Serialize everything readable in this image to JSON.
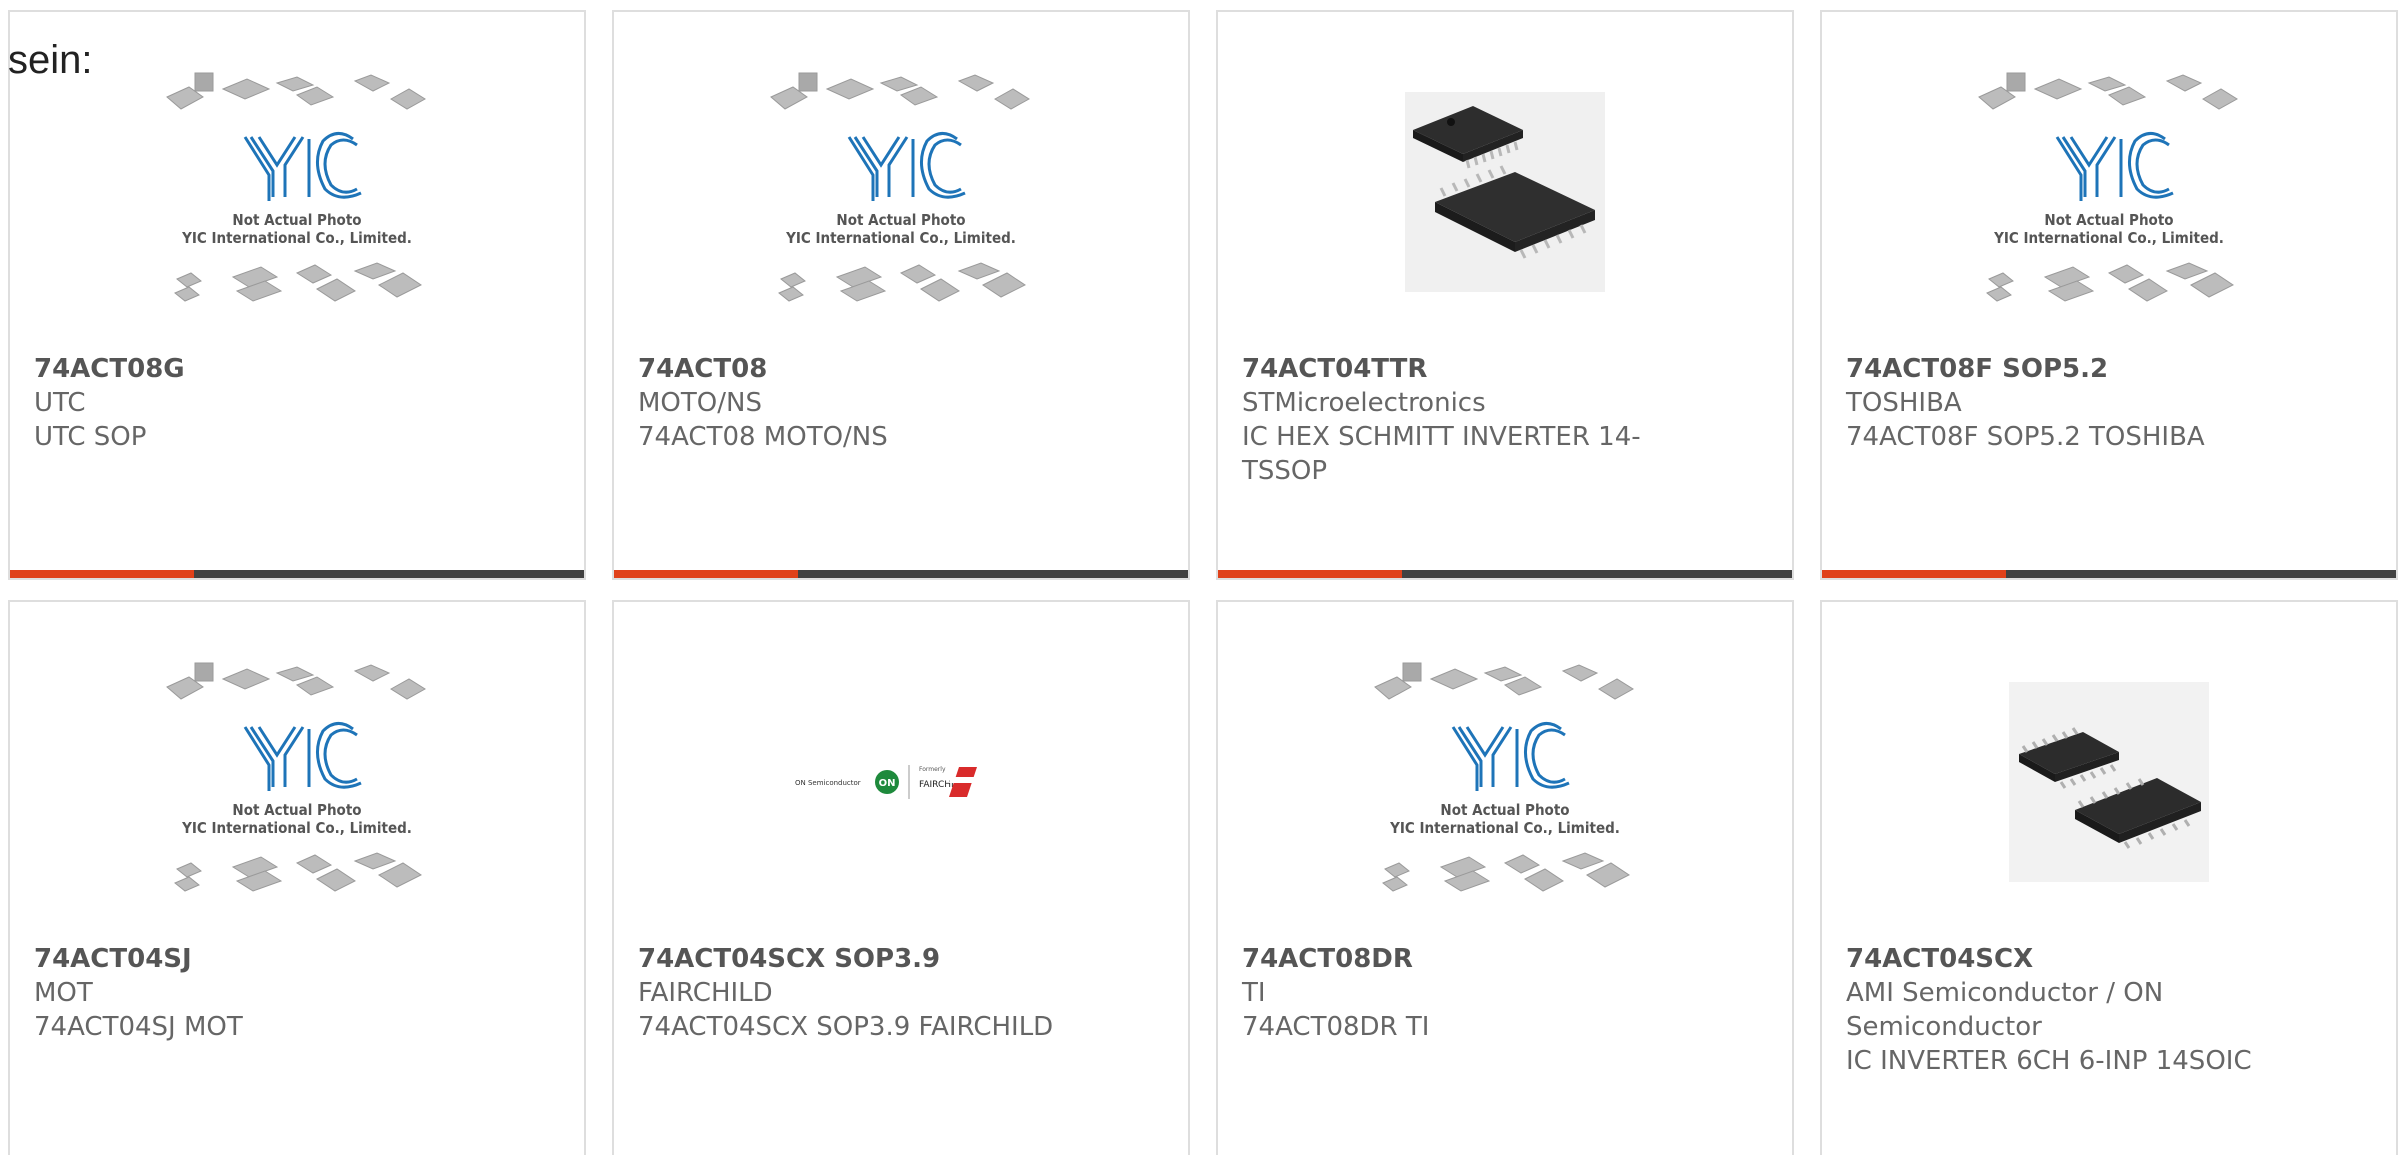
{
  "header": {
    "fragment": "sein:"
  },
  "placeholder": {
    "line1": "Not Actual Photo",
    "line2": "YIC International Co., Limited.",
    "logo": "YIC"
  },
  "colors": {
    "accent": "#e0411a",
    "bar": "#414141",
    "yic_blue": "#1e74b8"
  },
  "onsemi_logo": {
    "left_text": "ON Semiconductor",
    "badge": "ON",
    "formerly": "Formerly",
    "brand": "FAIRCHILD."
  },
  "cards": [
    {
      "part": "74ACT08G",
      "brand": "UTC",
      "desc": [
        "UTC SOP"
      ],
      "image": "yic-placeholder"
    },
    {
      "part": "74ACT08",
      "brand": "MOTO/NS",
      "desc": [
        "74ACT08 MOTO/NS"
      ],
      "image": "yic-placeholder"
    },
    {
      "part": "74ACT04TTR",
      "brand": "STMicroelectronics",
      "desc": [
        "IC HEX SCHMITT INVERTER 14-",
        "TSSOP"
      ],
      "image": "tssop-photo"
    },
    {
      "part": "74ACT08F SOP5.2",
      "brand": "TOSHIBA",
      "desc": [
        "74ACT08F SOP5.2 TOSHIBA"
      ],
      "image": "yic-placeholder"
    },
    {
      "part": "74ACT04SJ",
      "brand": "MOT",
      "desc": [
        "74ACT04SJ MOT"
      ],
      "image": "yic-placeholder"
    },
    {
      "part": "74ACT04SCX SOP3.9",
      "brand": "FAIRCHILD",
      "desc": [
        "74ACT04SCX SOP3.9 FAIRCHILD"
      ],
      "image": "onsemi-fairchild-logo"
    },
    {
      "part": "74ACT08DR",
      "brand": "TI",
      "desc": [
        "74ACT08DR TI"
      ],
      "image": "yic-placeholder"
    },
    {
      "part": "74ACT04SCX",
      "brand": "AMI Semiconductor / ON",
      "brand2": "Semiconductor",
      "desc": [
        "IC INVERTER 6CH 6-INP 14SOIC"
      ],
      "image": "soic-photo"
    }
  ]
}
